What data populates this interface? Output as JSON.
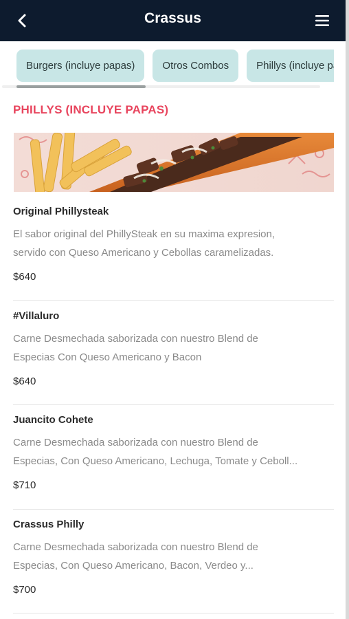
{
  "header": {
    "title": "Crassus",
    "back_icon": "chevron-left-icon",
    "menu_icon": "hamburger-menu-icon"
  },
  "categories": [
    {
      "label": "Burgers (incluye papas)"
    },
    {
      "label": "Otros Combos"
    },
    {
      "label": "Phillys (incluye papas)"
    }
  ],
  "section": {
    "title": "PHILLYS (INCLUYE PAPAS)"
  },
  "items": [
    {
      "name": "Original Phillysteak",
      "desc_line1": "El sabor original del PhillySteak en su maxima expresion,",
      "desc_line2": "servido con Queso Americano y Cebollas caramelizadas.",
      "price": "$640"
    },
    {
      "name": "#Villaluro",
      "desc_line1": "Carne Desmechada saborizada con nuestro Blend de",
      "desc_line2": "Especias Con Queso Americano y Bacon",
      "price": "$640"
    },
    {
      "name": "Juancito Cohete",
      "desc_line1": "Carne Desmechada saborizada con nuestro Blend de",
      "desc_line2": "Especias, Con Queso Americano, Lechuga, Tomate y Ceboll...",
      "price": "$710"
    },
    {
      "name": "Crassus Philly",
      "desc_line1": "Carne Desmechada saborizada con nuestro Blend de",
      "desc_line2": "Especias, Con Queso Americano, Bacon, Verdeo y...",
      "price": "$700"
    }
  ],
  "colors": {
    "header_bg": "#0d1b2e",
    "chip_bg": "#c8e6e6",
    "accent": "#e8445d"
  }
}
